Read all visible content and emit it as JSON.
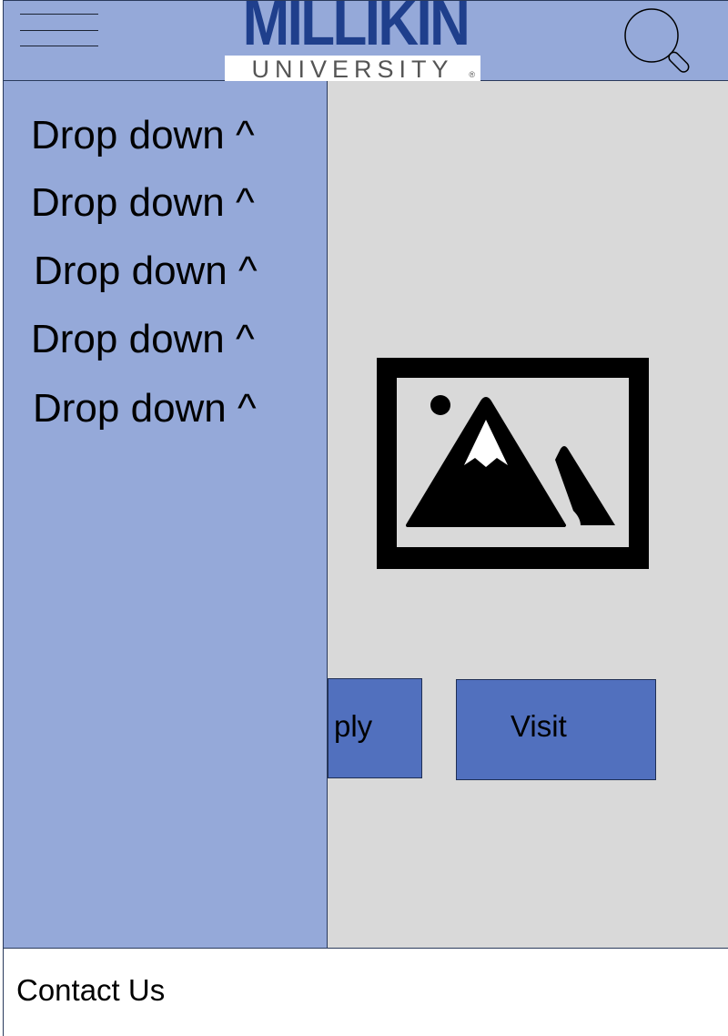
{
  "header": {
    "menu_icon": "hamburger-menu-icon",
    "logo": {
      "name": "MILLIKIN",
      "subtitle": "UNIVERSITY",
      "registered_mark": "®",
      "brand_color": "#1f3f8c"
    },
    "search_icon": "search-icon",
    "background_color": "#95a9d9"
  },
  "sidebar": {
    "items": [
      {
        "label": "Drop down ^"
      },
      {
        "label": "Drop down ^"
      },
      {
        "label": "Drop down ^"
      },
      {
        "label": "Drop down ^"
      },
      {
        "label": "Drop down ^"
      }
    ]
  },
  "main": {
    "image_placeholder_icon": "image-icon",
    "background_color": "#d9d9d9",
    "buttons": {
      "apply_label": "ply",
      "visit_label": "Visit",
      "button_color": "#5170be"
    }
  },
  "footer": {
    "contact_label": "Contact Us"
  }
}
